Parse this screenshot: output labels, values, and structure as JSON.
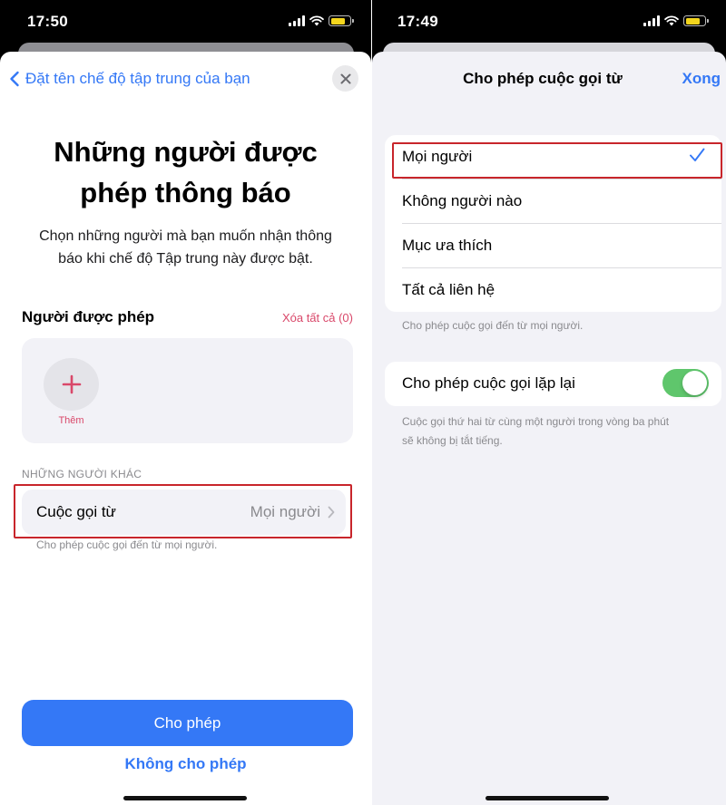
{
  "left": {
    "status": {
      "time": "17:50"
    },
    "header": {
      "back_label": "Đặt tên chế độ tập trung của bạn"
    },
    "title_line1": "Những người được",
    "title_line2": "phép thông báo",
    "subtitle_line1": "Chọn những người mà bạn muốn nhận thông",
    "subtitle_line2": "báo khi chế độ Tập trung này được bật.",
    "allowed_section": {
      "title": "Người được phép",
      "clear_all": "Xóa tất cả (0)",
      "add_label": "Thêm"
    },
    "others_section": {
      "header": "NHỮNG NGƯỜI KHÁC",
      "row_label": "Cuộc gọi từ",
      "row_value": "Mọi người",
      "footnote": "Cho phép cuộc gọi đến từ mọi người."
    },
    "buttons": {
      "allow": "Cho phép",
      "deny": "Không cho phép"
    }
  },
  "right": {
    "status": {
      "time": "17:49"
    },
    "nav": {
      "title": "Cho phép cuộc gọi từ",
      "done": "Xong"
    },
    "options": [
      {
        "label": "Mọi người",
        "selected": true
      },
      {
        "label": "Không người nào",
        "selected": false
      },
      {
        "label": "Mục ưa thích",
        "selected": false
      },
      {
        "label": "Tất cả liên hệ",
        "selected": false
      }
    ],
    "options_footnote": "Cho phép cuộc gọi đến từ mọi người.",
    "repeat": {
      "label": "Cho phép cuộc gọi lặp lại",
      "enabled": true
    },
    "repeat_footnote_line1": "Cuộc gọi thứ hai từ cùng một người trong vòng ba phút",
    "repeat_footnote_line2": "sẽ không bị tắt tiếng."
  },
  "colors": {
    "accent_blue": "#3478f6",
    "pink": "#d9486a",
    "toggle_green": "#5fc66c",
    "highlight_red": "#c8252b"
  }
}
